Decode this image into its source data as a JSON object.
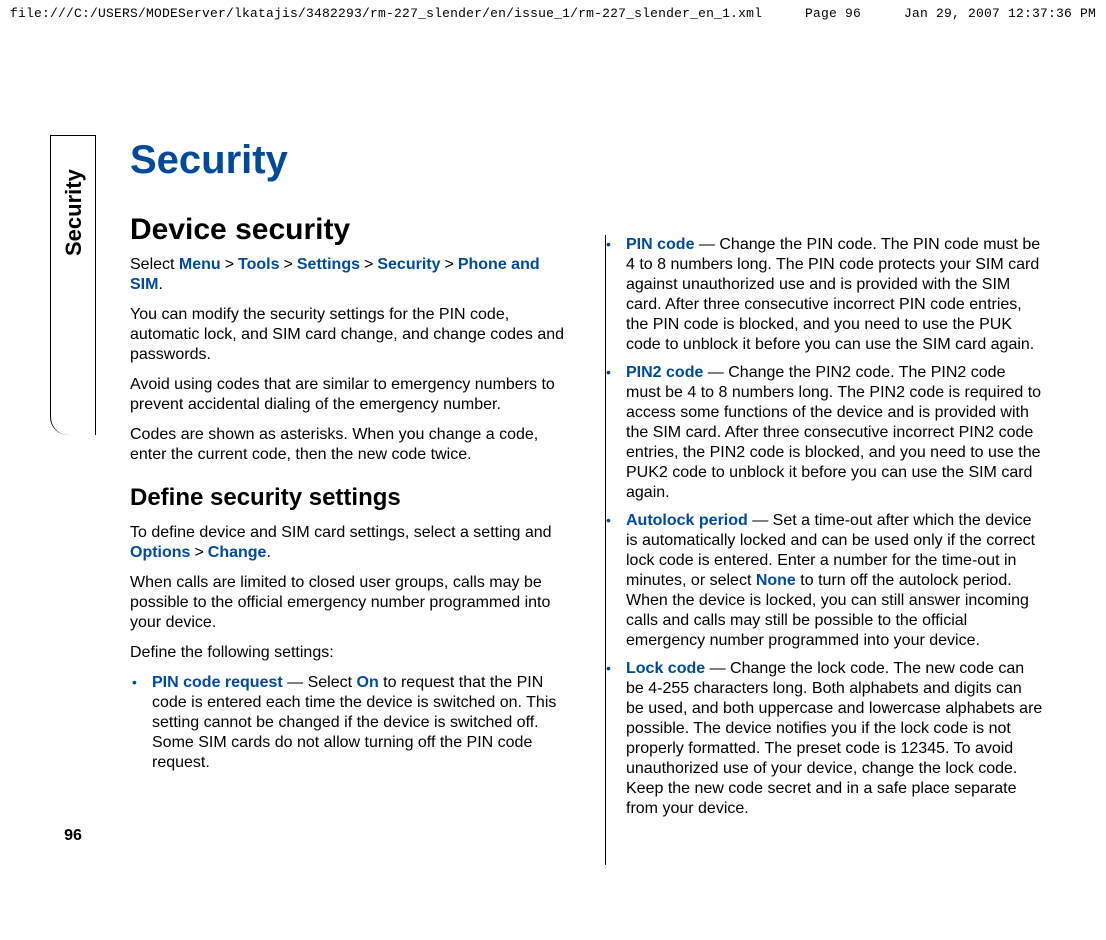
{
  "header": {
    "path": "file:///C:/USERS/MODEServer/lkatajis/3482293/rm-227_slender/en/issue_1/rm-227_slender_en_1.xml",
    "page": "Page 96",
    "timestamp": "Jan 29, 2007 12:37:36 PM"
  },
  "side_tab": "Security",
  "page_number": "96",
  "title": "Security",
  "section1": {
    "heading": "Device security",
    "nav_prefix": "Select ",
    "nav": [
      "Menu",
      "Tools",
      "Settings",
      "Security",
      "Phone and SIM"
    ],
    "nav_suffix": ".",
    "p1": "You can modify the security settings for the PIN code, automatic lock, and SIM card change, and change codes and passwords.",
    "p2": "Avoid using codes that are similar to emergency numbers to prevent accidental dialing of the emergency number.",
    "p3": "Codes are shown as asterisks. When you change a code, enter the current code, then the new code twice."
  },
  "section2": {
    "heading": "Define security settings",
    "intro_a": "To define device and SIM card settings, select a setting and ",
    "intro_opt": "Options",
    "intro_change": "Change",
    "intro_b": ".",
    "p1": "When calls are limited to closed user groups, calls may be possible to the official emergency number programmed into your device.",
    "p2": "Define the following settings:",
    "li1_term": "PIN code request",
    "li1_a": " — Select ",
    "li1_on": "On",
    "li1_b": " to request that the PIN code is entered each time the device is switched on. This setting cannot be changed if the device is switched off. Some SIM cards do not allow turning off the PIN code request."
  },
  "col2": {
    "li_pin_term": "PIN code",
    "li_pin_text": " — Change the PIN code. The PIN code must be 4 to 8 numbers long. The PIN code protects your SIM card against unauthorized use and is provided with the SIM card. After three consecutive incorrect PIN code entries, the PIN code is blocked, and you need to use the PUK code to unblock it before you can use the SIM card again.",
    "li_pin2_term": "PIN2 code",
    "li_pin2_text": " — Change the PIN2 code. The PIN2 code must be 4 to 8 numbers long. The PIN2 code is required to access some functions of the device and is provided with the SIM card. After three consecutive incorrect PIN2 code entries, the PIN2 code is blocked, and you need to use the PUK2 code to unblock it before you can use the SIM card again.",
    "li_auto_term": "Autolock period ",
    "li_auto_a": " — Set a time-out after which the device is automatically locked and can be used only if the correct lock code is entered. Enter a number for the time-out in minutes, or select ",
    "li_auto_none": "None",
    "li_auto_b": " to turn off the autolock period. When the device is locked, you can still answer incoming calls and calls may still be possible to the official emergency number programmed into your device.",
    "li_lock_term": "Lock code",
    "li_lock_text": " — Change the lock code. The new code can be 4-255 characters long. Both alphabets and digits can be used, and both uppercase and lowercase alphabets are possible. The device notifies you if the lock code is not properly formatted. The preset code is 12345. To avoid unauthorized use of your device, change the lock code. Keep the new code secret and in a safe place separate from your device."
  },
  "arrow_glyph": ">"
}
